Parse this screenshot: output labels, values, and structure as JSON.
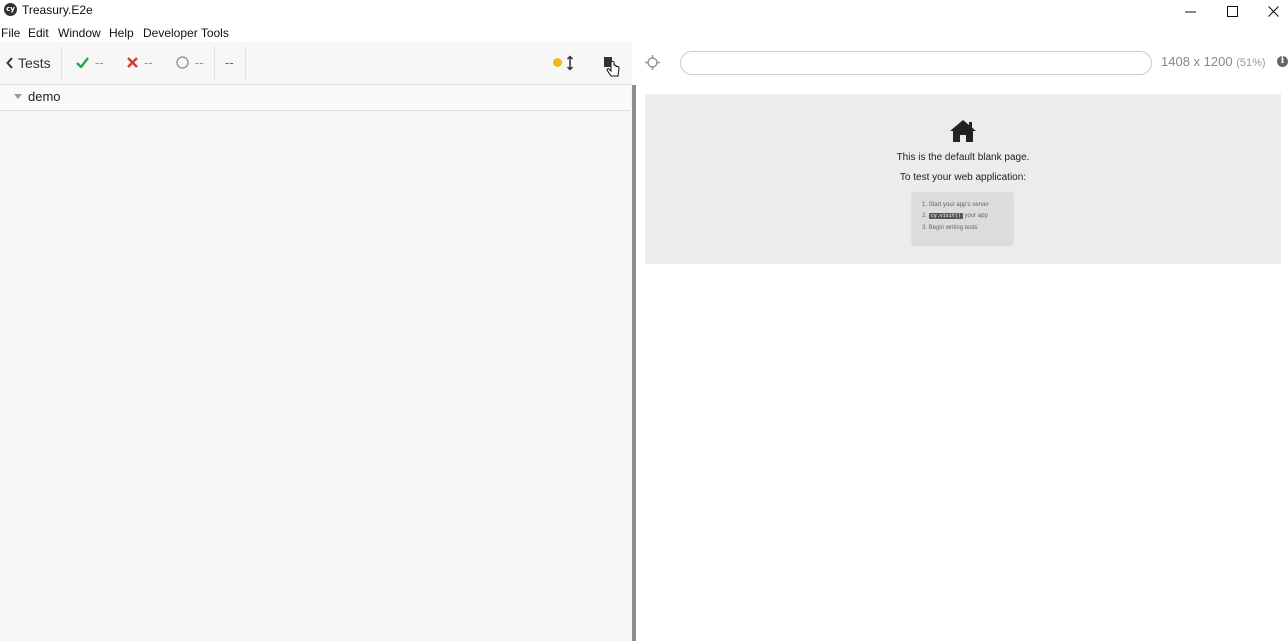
{
  "window": {
    "title": "Treasury.E2e",
    "logo_text": "cy",
    "minimize_glyph": "—",
    "maximize_glyph": "☐",
    "close_glyph": "✕"
  },
  "menu": [
    "File",
    "Edit",
    "Window",
    "Help",
    "Developer Tools"
  ],
  "toolbar": {
    "back_label": "Tests",
    "passed": "--",
    "failed": "--",
    "pending": "--",
    "duration": "--"
  },
  "colors": {
    "passed": "#27a54b",
    "failed": "#e0372b",
    "running_dot": "#f1b61a"
  },
  "specs": [
    {
      "name": "demo"
    }
  ],
  "viewport": {
    "url": "",
    "size": "1408 x 1200",
    "scale": "(51%)"
  },
  "blank_page": {
    "title": "This is the default blank page.",
    "subtitle": "To test your web application:",
    "steps": [
      {
        "prefix": "1.",
        "text": "Start your app's server"
      },
      {
        "prefix": "2.",
        "code": "cy.visit()",
        "text": " your app"
      },
      {
        "prefix": "3.",
        "text": "Begin writing tests"
      }
    ]
  }
}
